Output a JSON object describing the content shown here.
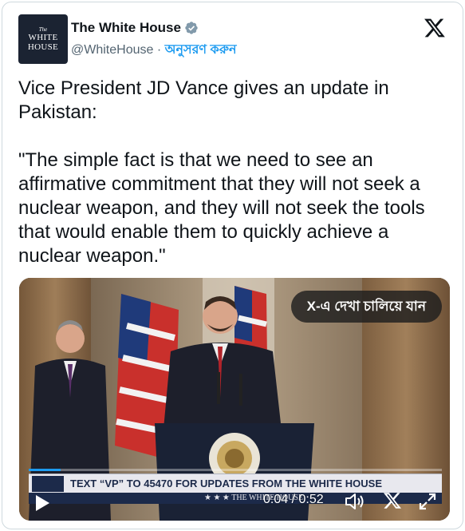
{
  "account": {
    "avatar_lines": [
      "The",
      "WHITE",
      "HOUSE"
    ],
    "display_name": "The White House",
    "handle": "@WhiteHouse",
    "separator": " · ",
    "follow_label": "অনুসরণ করুন"
  },
  "tweet": {
    "text": "Vice President JD Vance gives an update in Pakistan:\n\n\"The simple fact is that we need to see an affirmative commitment that they will not seek a nuclear weapon, and they will not seek the tools that would enable them to quickly achieve a nuclear weapon.\""
  },
  "video": {
    "watch_on_x_label": "X-এ দেখা চালিয়ে যান",
    "ticker_text": "TEXT “VP” TO 45470 FOR UPDATES FROM THE WHITE HOUSE",
    "lower_text": "★ ★ ★  THE WHITE HOUSE",
    "time_label": "0:04 / 0:52",
    "progress_fraction": 0.077
  },
  "icons": {
    "verified": "verified-badge-icon",
    "x_logo": "x-logo-icon",
    "play": "play-icon",
    "volume": "volume-icon",
    "x_small": "x-logo-small-icon",
    "fullscreen": "fullscreen-icon"
  },
  "colors": {
    "link": "#1d9bf0",
    "secondary_text": "#536471",
    "text": "#0f1419",
    "avatar_bg": "#1b2332"
  }
}
